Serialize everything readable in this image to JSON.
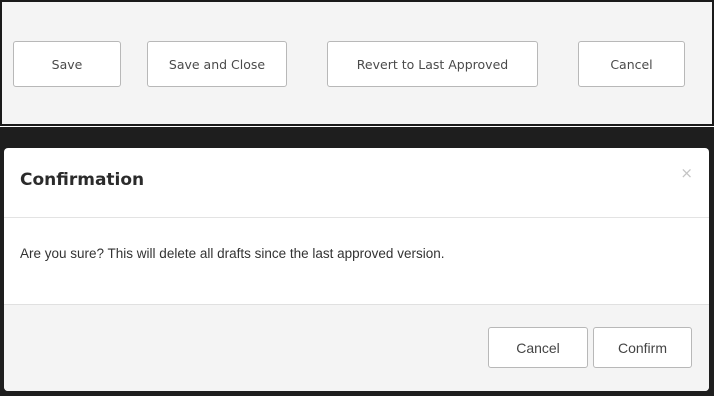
{
  "toolbar": {
    "save_label": "Save",
    "save_and_close_label": "Save and Close",
    "revert_label": "Revert to Last Approved",
    "cancel_label": "Cancel"
  },
  "modal": {
    "title": "Confirmation",
    "close_glyph": "×",
    "message": "Are you sure? This will delete all drafts since the last approved version.",
    "cancel_label": "Cancel",
    "confirm_label": "Confirm"
  }
}
